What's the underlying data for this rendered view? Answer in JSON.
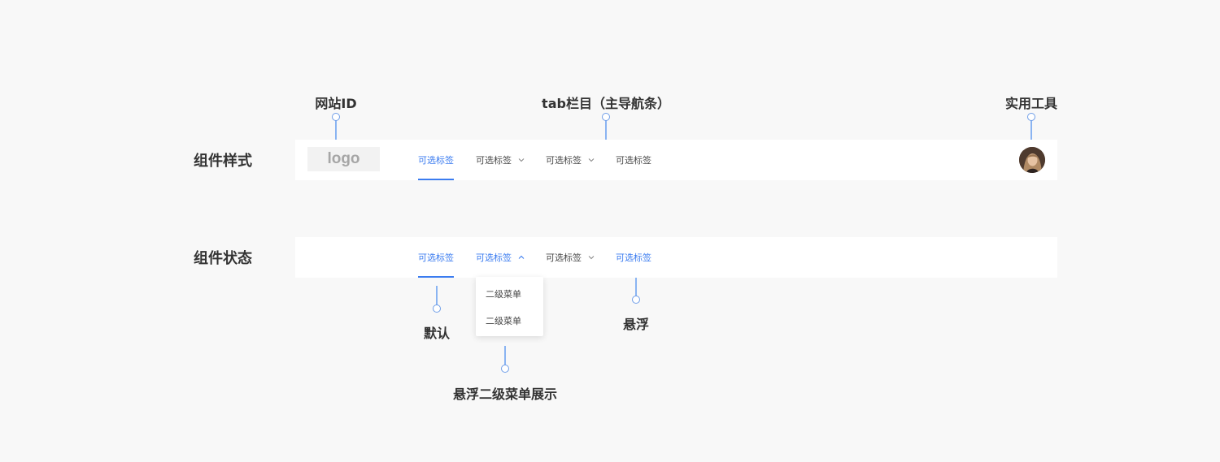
{
  "annotations": {
    "site_id": "网站ID",
    "tab_bar": "tab栏目（主导航条）",
    "utility": "实用工具",
    "default": "默认",
    "hover": "悬浮",
    "hover_submenu": "悬浮二级菜单展示"
  },
  "rows": {
    "style_label": "组件样式",
    "state_label": "组件状态"
  },
  "logo": {
    "text": "logo"
  },
  "nav_style": {
    "tabs": [
      {
        "label": "可选标签",
        "state": "active",
        "dropdown": false
      },
      {
        "label": "可选标签",
        "state": "normal",
        "dropdown": true,
        "chevron": "chevron-down-icon"
      },
      {
        "label": "可选标签",
        "state": "normal",
        "dropdown": true,
        "chevron": "chevron-down-icon"
      },
      {
        "label": "可选标签",
        "state": "normal",
        "dropdown": false
      }
    ]
  },
  "nav_state": {
    "tabs": [
      {
        "label": "可选标签",
        "state": "active",
        "dropdown": false
      },
      {
        "label": "可选标签",
        "state": "hover",
        "dropdown": true,
        "chevron": "chevron-up-icon"
      },
      {
        "label": "可选标签",
        "state": "normal",
        "dropdown": true,
        "chevron": "chevron-down-icon"
      },
      {
        "label": "可选标签",
        "state": "hover",
        "dropdown": false
      }
    ],
    "submenu": {
      "items": [
        {
          "label": "二级菜单"
        },
        {
          "label": "二级菜单"
        }
      ]
    }
  },
  "colors": {
    "accent": "#3b7cf0",
    "connector": "#8ab4f2",
    "background": "#f8f8f8",
    "navbar": "#ffffff",
    "text": "#333333"
  }
}
